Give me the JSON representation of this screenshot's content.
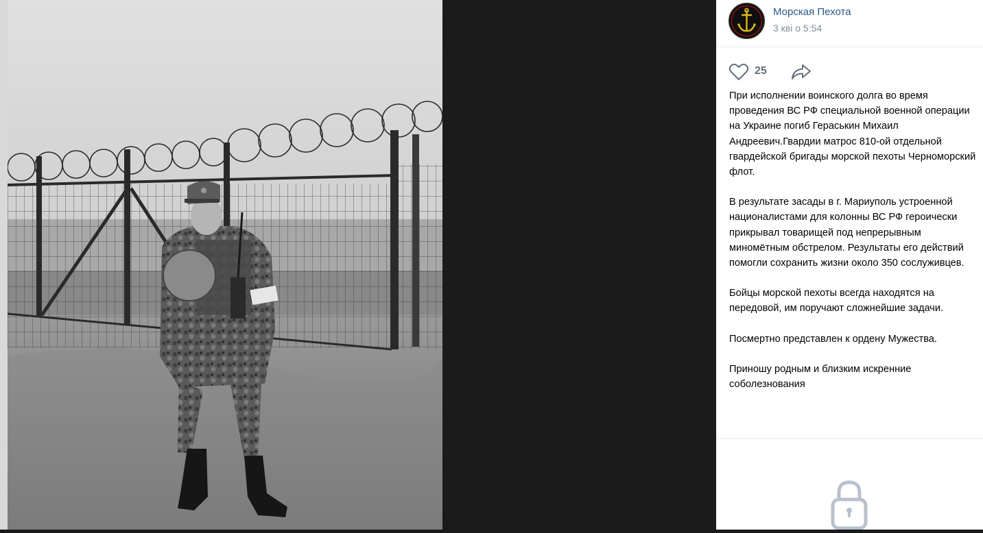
{
  "post": {
    "group_name": "Морская Пехота",
    "date": "3 кві о 5:54",
    "likes": "25",
    "paragraphs": [
      "При исполнении воинского долга во время проведения ВС РФ специальной военной операции на Украине погиб Гераськин Михаил Андреевич.Гвардии матрос 810-ой отдельной гвардейской бригады морской пехоты Черноморский флот.",
      "В результате засады в г. Мариуполь устроенной националистами для колонны ВС РФ героически прикрывал товарищей под непрерывным миномётным обстрелом. Результаты его действий помогли сохранить жизни около 350 сослуживцев.",
      "Бойцы морской пехоты всегда находятся на передовой, им поручают сложнейшие задачи.",
      "Посмертно представлен к ордену Мужества.",
      "Приношу родным и близким искренние соболезнования"
    ]
  },
  "icons": {
    "like": "heart-icon",
    "share": "share-arrow-icon",
    "lock": "lock-icon",
    "avatar": "anchor-emblem"
  },
  "colors": {
    "link": "#2a5885",
    "muted": "#818c99",
    "icon": "#626d7a",
    "divider": "#e7e8ec"
  }
}
